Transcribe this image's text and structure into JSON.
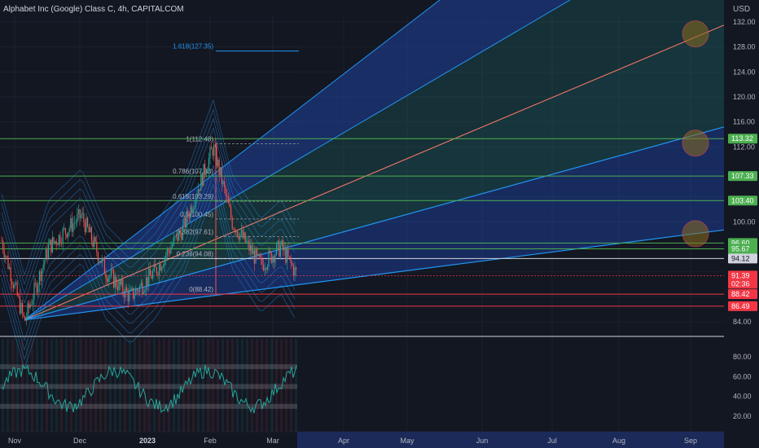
{
  "header": {
    "title": "Alphabet Inc (Google) Class C, 4h, CAPITALCOM",
    "currency": "USD"
  },
  "colors": {
    "background": "#131722",
    "grid": "#1e222d",
    "text": "#b2b5be",
    "candle_up": "#26a69a",
    "candle_down": "#ef5350",
    "fan_blue": "#2962ff",
    "fan_line": "#2196f3",
    "fan_red": "#ff7a6b",
    "fib_green": "#4caf50",
    "fib_line": "#2196f3",
    "marker": "#ff5252",
    "tag_green": "#4caf50",
    "tag_red": "#f23645",
    "tag_white": "#d1d4dc"
  },
  "chart_data": [
    {
      "type": "candlestick",
      "title": "Alphabet Inc (Google) Class C, 4h, CAPITALCOM",
      "ylabel": "USD",
      "ylim": [
        80,
        134
      ],
      "x_tick_labels": [
        "Nov",
        "Dec",
        "2023",
        "Feb",
        "Mar",
        "Apr",
        "May",
        "Jun",
        "Jul",
        "Aug",
        "Sep"
      ],
      "y_tick_labels": [
        "132.00",
        "128.00",
        "124.00",
        "120.00",
        "116.00",
        "112.00",
        "100.00",
        "84.00"
      ],
      "last_price": 91.39,
      "countdown": "02:36",
      "price_tags": [
        {
          "label": "113.32",
          "value": 113.32,
          "style": "green"
        },
        {
          "label": "107.33",
          "value": 107.33,
          "style": "green"
        },
        {
          "label": "103.40",
          "value": 103.4,
          "style": "green"
        },
        {
          "label": "96.60",
          "value": 96.6,
          "style": "green"
        },
        {
          "label": "95.67",
          "value": 95.67,
          "style": "green"
        },
        {
          "label": "94.12",
          "value": 94.12,
          "style": "white"
        },
        {
          "label": "91.39",
          "value": 91.39,
          "style": "red"
        },
        {
          "label": "88.42",
          "value": 88.42,
          "style": "red"
        },
        {
          "label": "86.49",
          "value": 86.49,
          "style": "red"
        }
      ],
      "fib_levels": [
        {
          "label": "1.618(127.35)",
          "value": 127.35
        },
        {
          "label": "1(112.48)",
          "value": 112.48
        },
        {
          "label": "0.786(107.33)",
          "value": 107.33
        },
        {
          "label": "0.618(103.29)",
          "value": 103.29
        },
        {
          "label": "0.5(100.45)",
          "value": 100.45
        },
        {
          "label": "0.382(97.61)",
          "value": 97.61
        },
        {
          "label": "0.236(94.08)",
          "value": 94.08
        },
        {
          "label": "0(88.42)",
          "value": 88.42
        }
      ],
      "horizontal_lines": [
        113.32,
        107.33,
        103.4,
        96.6,
        95.67,
        94.12,
        88.42,
        86.49
      ],
      "markers": [
        {
          "month": "Sep",
          "value": 130.1
        },
        {
          "month": "Sep",
          "value": 112.6
        },
        {
          "month": "Sep",
          "value": 98.1
        }
      ]
    },
    {
      "type": "line",
      "title": "",
      "ylim": [
        10,
        95
      ],
      "y_tick_labels": [
        "80.00",
        "60.00",
        "40.00",
        "20.00"
      ],
      "bands": [
        70,
        50,
        30
      ]
    }
  ]
}
